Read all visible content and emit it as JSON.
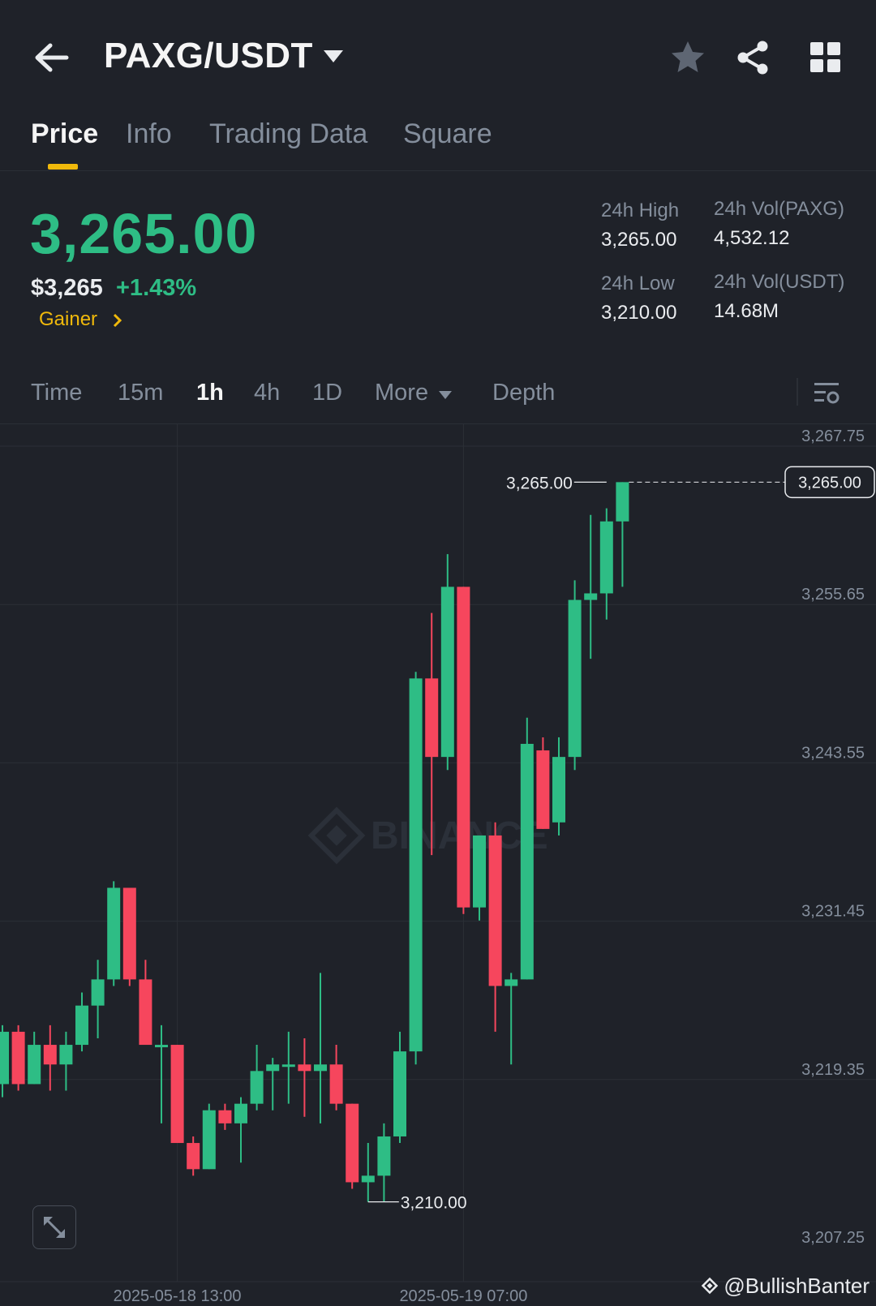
{
  "header": {
    "pair": "PAXG/USDT",
    "icons": [
      "back-arrow-icon",
      "caret-down-icon",
      "star-icon",
      "share-icon",
      "grid-icon"
    ]
  },
  "tabs": [
    {
      "label": "Price",
      "active": true
    },
    {
      "label": "Info",
      "active": false
    },
    {
      "label": "Trading Data",
      "active": false
    },
    {
      "label": "Square",
      "active": false
    }
  ],
  "price": {
    "last": "3,265.00",
    "fiat": "$3,265",
    "change": "+1.43%",
    "tag": "Gainer"
  },
  "stats": {
    "high_label": "24h High",
    "high_value": "3,265.00",
    "low_label": "24h Low",
    "low_value": "3,210.00",
    "vol_base_label": "24h Vol(PAXG)",
    "vol_base_value": "4,532.12",
    "vol_quote_label": "24h Vol(USDT)",
    "vol_quote_value": "14.68M"
  },
  "intervals": {
    "items": [
      {
        "label": "Time",
        "active": false
      },
      {
        "label": "15m",
        "active": false
      },
      {
        "label": "1h",
        "active": true
      },
      {
        "label": "4h",
        "active": false
      },
      {
        "label": "1D",
        "active": false
      },
      {
        "label": "More",
        "active": false
      },
      {
        "label": "Depth",
        "active": false
      }
    ]
  },
  "colors": {
    "up": "#2ebd85",
    "down": "#f6465d",
    "accent": "#f0b90b",
    "bg": "#1f2229"
  },
  "chart_data": {
    "type": "candlestick",
    "interval": "1h",
    "y_ticks": [
      "3,267.75",
      "3,255.65",
      "3,243.55",
      "3,231.45",
      "3,219.35",
      "3,207.25"
    ],
    "ylim": [
      3207.25,
      3267.75
    ],
    "x_ticks": [
      {
        "label": "2025-05-18 13:00",
        "index": 11
      },
      {
        "label": "2025-05-19 07:00",
        "index": 29
      }
    ],
    "last_price_label": "3,265.00",
    "high_marker": {
      "label": "3,265.00",
      "index": 38,
      "value": 3265.0
    },
    "low_marker": {
      "label": "3,210.00",
      "index": 23,
      "value": 3210.0
    },
    "watermark": "BINANCE",
    "candles": [
      {
        "o": 3219.0,
        "h": 3223.5,
        "l": 3218.0,
        "c": 3223.0
      },
      {
        "o": 3223.0,
        "h": 3223.5,
        "l": 3218.5,
        "c": 3219.0
      },
      {
        "o": 3219.0,
        "h": 3223.0,
        "l": 3219.0,
        "c": 3222.0
      },
      {
        "o": 3222.0,
        "h": 3223.5,
        "l": 3218.5,
        "c": 3220.5
      },
      {
        "o": 3220.5,
        "h": 3223.0,
        "l": 3218.5,
        "c": 3222.0
      },
      {
        "o": 3222.0,
        "h": 3226.0,
        "l": 3221.5,
        "c": 3225.0
      },
      {
        "o": 3225.0,
        "h": 3228.5,
        "l": 3222.5,
        "c": 3227.0
      },
      {
        "o": 3227.0,
        "h": 3234.5,
        "l": 3226.5,
        "c": 3234.0
      },
      {
        "o": 3234.0,
        "h": 3234.0,
        "l": 3226.5,
        "c": 3227.0
      },
      {
        "o": 3227.0,
        "h": 3228.5,
        "l": 3222.0,
        "c": 3222.0
      },
      {
        "o": 3222.0,
        "h": 3223.5,
        "l": 3216.0,
        "c": 3222.0
      },
      {
        "o": 3222.0,
        "h": 3222.0,
        "l": 3214.5,
        "c": 3214.5
      },
      {
        "o": 3214.5,
        "h": 3215.0,
        "l": 3212.0,
        "c": 3212.5
      },
      {
        "o": 3212.5,
        "h": 3217.5,
        "l": 3212.5,
        "c": 3217.0
      },
      {
        "o": 3217.0,
        "h": 3217.5,
        "l": 3215.5,
        "c": 3216.0
      },
      {
        "o": 3216.0,
        "h": 3218.0,
        "l": 3213.0,
        "c": 3217.5
      },
      {
        "o": 3217.5,
        "h": 3222.0,
        "l": 3217.0,
        "c": 3220.0
      },
      {
        "o": 3220.0,
        "h": 3221.0,
        "l": 3217.0,
        "c": 3220.5
      },
      {
        "o": 3220.5,
        "h": 3223.0,
        "l": 3217.5,
        "c": 3220.5
      },
      {
        "o": 3220.5,
        "h": 3222.5,
        "l": 3216.5,
        "c": 3220.0
      },
      {
        "o": 3220.0,
        "h": 3227.5,
        "l": 3216.0,
        "c": 3220.5
      },
      {
        "o": 3220.5,
        "h": 3222.0,
        "l": 3217.0,
        "c": 3217.5
      },
      {
        "o": 3217.5,
        "h": 3217.5,
        "l": 3211.0,
        "c": 3211.5
      },
      {
        "o": 3211.5,
        "h": 3214.5,
        "l": 3210.0,
        "c": 3212.0
      },
      {
        "o": 3212.0,
        "h": 3216.0,
        "l": 3210.0,
        "c": 3215.0
      },
      {
        "o": 3215.0,
        "h": 3223.0,
        "l": 3214.5,
        "c": 3221.5
      },
      {
        "o": 3221.5,
        "h": 3250.5,
        "l": 3220.5,
        "c": 3250.0
      },
      {
        "o": 3250.0,
        "h": 3255.0,
        "l": 3236.5,
        "c": 3244.0
      },
      {
        "o": 3244.0,
        "h": 3259.5,
        "l": 3243.0,
        "c": 3257.0
      },
      {
        "o": 3257.0,
        "h": 3257.0,
        "l": 3232.0,
        "c": 3232.5
      },
      {
        "o": 3232.5,
        "h": 3233.0,
        "l": 3231.5,
        "c": 3238.0
      },
      {
        "o": 3238.0,
        "h": 3239.0,
        "l": 3223.0,
        "c": 3226.5
      },
      {
        "o": 3226.5,
        "h": 3227.5,
        "l": 3220.5,
        "c": 3227.0
      },
      {
        "o": 3227.0,
        "h": 3247.0,
        "l": 3227.0,
        "c": 3245.0
      },
      {
        "o": 3244.5,
        "h": 3245.5,
        "l": 3238.5,
        "c": 3238.5
      },
      {
        "o": 3239.0,
        "h": 3245.5,
        "l": 3238.0,
        "c": 3244.0
      },
      {
        "o": 3244.0,
        "h": 3257.5,
        "l": 3243.0,
        "c": 3256.0
      },
      {
        "o": 3256.0,
        "h": 3262.5,
        "l": 3251.5,
        "c": 3256.5
      },
      {
        "o": 3256.5,
        "h": 3263.0,
        "l": 3254.5,
        "c": 3262.0
      },
      {
        "o": 3262.0,
        "h": 3265.0,
        "l": 3257.0,
        "c": 3265.0
      }
    ]
  },
  "credit": "@BullishBanter"
}
